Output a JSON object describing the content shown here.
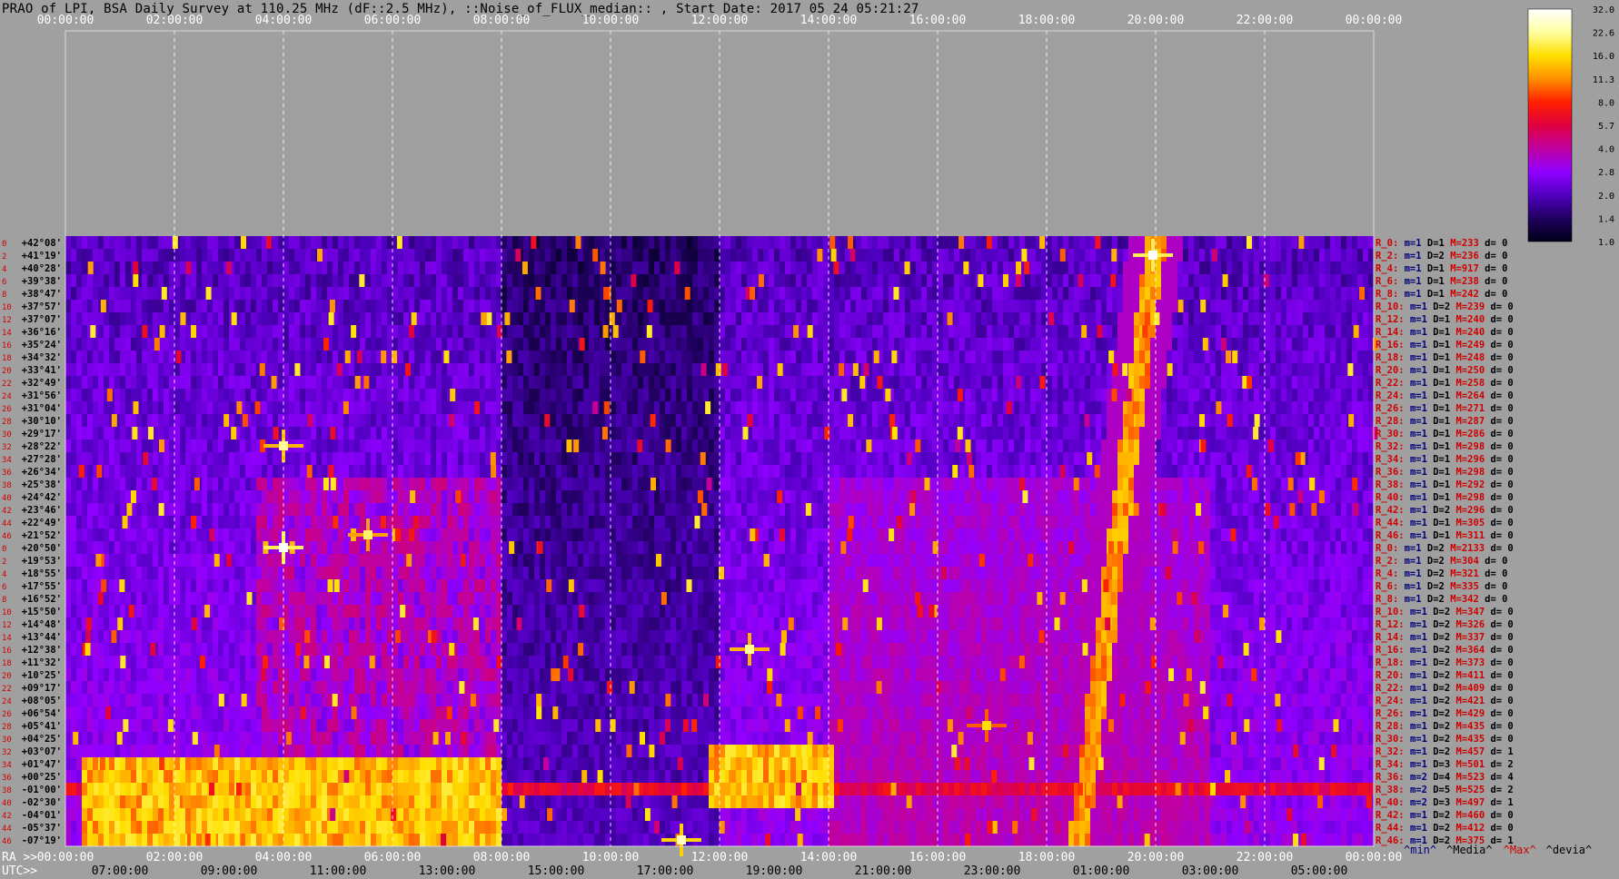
{
  "title": "PRAO of LPI, BSA Daily Survey at 110.25 MHz (dF::2.5 MHz), ::Noise_of_FLUX_median:: , Start Date: 2017 05 24 05:21:27",
  "colors": {
    "background": "#a0a0a0",
    "text_red": "#d00000",
    "text_navy": "#00007a",
    "text_black": "#000000"
  },
  "chart_data": {
    "type": "heatmap",
    "title": "PRAO of LPI, BSA Daily Survey at 110.25 MHz (dF::2.5 MHz), ::Noise_of_FLUX_median:: , Start Date: 2017 05 24 05:21:27",
    "top_axis_ticks": [
      "00:00:00",
      "02:00:00",
      "04:00:00",
      "06:00:00",
      "08:00:00",
      "10:00:00",
      "12:00:00",
      "14:00:00",
      "16:00:00",
      "18:00:00",
      "20:00:00",
      "22:00:00",
      "00:00:00"
    ],
    "ra_axis": {
      "prefix": "RA >>",
      "ticks": [
        "00:00:00",
        "02:00:00",
        "04:00:00",
        "06:00:00",
        "08:00:00",
        "10:00:00",
        "12:00:00",
        "14:00:00",
        "16:00:00",
        "18:00:00",
        "20:00:00",
        "22:00:00",
        "00:00:00"
      ]
    },
    "utc_axis": {
      "prefix": "UTC>>",
      "ticks": [
        "07:00:00",
        "09:00:00",
        "11:00:00",
        "13:00:00",
        "15:00:00",
        "17:00:00",
        "19:00:00",
        "21:00:00",
        "23:00:00",
        "01:00:00",
        "03:00:00",
        "05:00:00"
      ]
    },
    "x_range_hours": [
      0,
      24
    ],
    "declinations": [
      "+42°08'",
      "+41°19'",
      "+40°28'",
      "+39°38'",
      "+38°47'",
      "+37°57'",
      "+37°07'",
      "+36°16'",
      "+35°24'",
      "+34°32'",
      "+33°41'",
      "+32°49'",
      "+31°56'",
      "+31°04'",
      "+30°10'",
      "+29°17'",
      "+28°22'",
      "+27°28'",
      "+26°34'",
      "+25°38'",
      "+24°42'",
      "+23°46'",
      "+22°49'",
      "+21°52'",
      "+20°50'",
      "+19°53'",
      "+18°55'",
      "+17°55'",
      "+16°52'",
      "+15°50'",
      "+14°48'",
      "+13°44'",
      "+12°38'",
      "+11°32'",
      "+10°25'",
      "+09°17'",
      "+08°05'",
      "+06°54'",
      "+05°41'",
      "+04°25'",
      "+03°07'",
      "+01°47'",
      "+00°25'",
      "-01°00'",
      "-02°30'",
      "-04°01'",
      "-05°37'",
      "-07°19'"
    ],
    "row_indices": [
      "0",
      "2",
      "4",
      "6",
      "8",
      "10",
      "12",
      "14",
      "16",
      "18",
      "20",
      "22",
      "24",
      "26",
      "28",
      "30",
      "32",
      "34",
      "36",
      "38",
      "40",
      "42",
      "44",
      "46",
      "0",
      "2",
      "4",
      "6",
      "8",
      "10",
      "12",
      "14",
      "16",
      "18",
      "20",
      "22",
      "24",
      "26",
      "28",
      "30",
      "32",
      "34",
      "36",
      "38",
      "40",
      "42",
      "44",
      "46"
    ],
    "colorbar": {
      "ticks": [
        "32.0",
        "22.6",
        "16.0",
        "11.3",
        "8.0",
        "5.7",
        "4.0",
        "2.8",
        "2.0",
        "1.4",
        "1.0"
      ],
      "scale": "log",
      "range": [
        1.0,
        32.0
      ],
      "colors": [
        "#ffffff",
        "#ffffa0",
        "#ffe000",
        "#ff9000",
        "#ff2000",
        "#e00040",
        "#c000a0",
        "#9000ff",
        "#5000c0",
        "#200060",
        "#000018"
      ]
    },
    "row_stats": [
      {
        "label": "R_0:",
        "m": 1,
        "D": 1,
        "M": 233,
        "d": 0
      },
      {
        "label": "R_2:",
        "m": 1,
        "D": 2,
        "M": 236,
        "d": 0
      },
      {
        "label": "R_4:",
        "m": 1,
        "D": 1,
        "M": 917,
        "d": 0
      },
      {
        "label": "R_6:",
        "m": 1,
        "D": 1,
        "M": 238,
        "d": 0
      },
      {
        "label": "R_8:",
        "m": 1,
        "D": 1,
        "M": 242,
        "d": 0
      },
      {
        "label": "R_10:",
        "m": 1,
        "D": 2,
        "M": 239,
        "d": 0
      },
      {
        "label": "R_12:",
        "m": 1,
        "D": 1,
        "M": 240,
        "d": 0
      },
      {
        "label": "R_14:",
        "m": 1,
        "D": 1,
        "M": 240,
        "d": 0
      },
      {
        "label": "R_16:",
        "m": 1,
        "D": 1,
        "M": 249,
        "d": 0
      },
      {
        "label": "R_18:",
        "m": 1,
        "D": 1,
        "M": 248,
        "d": 0
      },
      {
        "label": "R_20:",
        "m": 1,
        "D": 1,
        "M": 250,
        "d": 0
      },
      {
        "label": "R_22:",
        "m": 1,
        "D": 1,
        "M": 258,
        "d": 0
      },
      {
        "label": "R_24:",
        "m": 1,
        "D": 1,
        "M": 264,
        "d": 0
      },
      {
        "label": "R_26:",
        "m": 1,
        "D": 1,
        "M": 271,
        "d": 0
      },
      {
        "label": "R_28:",
        "m": 1,
        "D": 1,
        "M": 287,
        "d": 0
      },
      {
        "label": "R_30:",
        "m": 1,
        "D": 1,
        "M": 286,
        "d": 0
      },
      {
        "label": "R_32:",
        "m": 1,
        "D": 1,
        "M": 298,
        "d": 0
      },
      {
        "label": "R_34:",
        "m": 1,
        "D": 1,
        "M": 296,
        "d": 0
      },
      {
        "label": "R_36:",
        "m": 1,
        "D": 1,
        "M": 298,
        "d": 0
      },
      {
        "label": "R_38:",
        "m": 1,
        "D": 1,
        "M": 292,
        "d": 0
      },
      {
        "label": "R_40:",
        "m": 1,
        "D": 1,
        "M": 298,
        "d": 0
      },
      {
        "label": "R_42:",
        "m": 1,
        "D": 2,
        "M": 296,
        "d": 0
      },
      {
        "label": "R_44:",
        "m": 1,
        "D": 1,
        "M": 305,
        "d": 0
      },
      {
        "label": "R_46:",
        "m": 1,
        "D": 1,
        "M": 311,
        "d": 0
      },
      {
        "label": "R_0:",
        "m": 1,
        "D": 2,
        "M": 2133,
        "d": 0
      },
      {
        "label": "R_2:",
        "m": 1,
        "D": 2,
        "M": 304,
        "d": 0
      },
      {
        "label": "R_4:",
        "m": 1,
        "D": 2,
        "M": 321,
        "d": 0
      },
      {
        "label": "R_6:",
        "m": 1,
        "D": 2,
        "M": 335,
        "d": 0
      },
      {
        "label": "R_8:",
        "m": 1,
        "D": 2,
        "M": 342,
        "d": 0
      },
      {
        "label": "R_10:",
        "m": 1,
        "D": 2,
        "M": 347,
        "d": 0
      },
      {
        "label": "R_12:",
        "m": 1,
        "D": 2,
        "M": 326,
        "d": 0
      },
      {
        "label": "R_14:",
        "m": 1,
        "D": 2,
        "M": 337,
        "d": 0
      },
      {
        "label": "R_16:",
        "m": 1,
        "D": 2,
        "M": 364,
        "d": 0
      },
      {
        "label": "R_18:",
        "m": 1,
        "D": 2,
        "M": 373,
        "d": 0
      },
      {
        "label": "R_20:",
        "m": 1,
        "D": 2,
        "M": 411,
        "d": 0
      },
      {
        "label": "R_22:",
        "m": 1,
        "D": 2,
        "M": 409,
        "d": 0
      },
      {
        "label": "R_24:",
        "m": 1,
        "D": 2,
        "M": 421,
        "d": 0
      },
      {
        "label": "R_26:",
        "m": 1,
        "D": 2,
        "M": 429,
        "d": 0
      },
      {
        "label": "R_28:",
        "m": 1,
        "D": 2,
        "M": 435,
        "d": 0
      },
      {
        "label": "R_30:",
        "m": 1,
        "D": 2,
        "M": 435,
        "d": 0
      },
      {
        "label": "R_32:",
        "m": 1,
        "D": 2,
        "M": 457,
        "d": 1
      },
      {
        "label": "R_34:",
        "m": 1,
        "D": 3,
        "M": 501,
        "d": 2
      },
      {
        "label": "R_36:",
        "m": 2,
        "D": 4,
        "M": 523,
        "d": 4
      },
      {
        "label": "R_38:",
        "m": 2,
        "D": 5,
        "M": 525,
        "d": 2
      },
      {
        "label": "R_40:",
        "m": 2,
        "D": 3,
        "M": 497,
        "d": 1
      },
      {
        "label": "R_42:",
        "m": 1,
        "D": 2,
        "M": 460,
        "d": 0
      },
      {
        "label": "R_44:",
        "m": 1,
        "D": 2,
        "M": 412,
        "d": 0
      },
      {
        "label": "R_46:",
        "m": 1,
        "D": 2,
        "M": 375,
        "d": 1
      }
    ],
    "stats_legend": [
      {
        "text": "^min^",
        "color": "#00007a"
      },
      {
        "text": "^Media^",
        "color": "#000000"
      },
      {
        "text": "^Max^",
        "color": "#d00000"
      },
      {
        "text": "^devia^",
        "color": "#000000"
      }
    ],
    "features": {
      "dense_blocks": [
        {
          "ra_start_h": 0.3,
          "ra_end_h": 8.0,
          "dec_from": "+01°47'",
          "dec_to": "-07°19'",
          "level": 14
        },
        {
          "ra_start_h": 11.8,
          "ra_end_h": 14.1,
          "dec_from": "+03°07'",
          "dec_to": "-02°30'",
          "level": 14
        },
        {
          "ra_start_h": 3.5,
          "ra_end_h": 8.0,
          "dec_from": "+25°38'",
          "dec_to": "+03°07'",
          "level": 3.5
        }
      ],
      "bright_sources": [
        {
          "ra_h": 19.95,
          "dec": "+41°19'",
          "level": 32
        },
        {
          "ra_h": 4.0,
          "dec": "+20°50'",
          "level": 32
        },
        {
          "ra_h": 5.55,
          "dec": "+21°52'",
          "level": 20
        },
        {
          "ra_h": 4.0,
          "dec": "+28°22'",
          "level": 22
        },
        {
          "ra_h": 12.55,
          "dec": "+12°38'",
          "level": 22
        },
        {
          "ra_h": 11.3,
          "dec": "-07°19'",
          "level": 25
        },
        {
          "ra_h": 16.9,
          "dec": "+05°41'",
          "level": 16
        }
      ],
      "diagonal_track": {
        "ra_start_h": 18.6,
        "dec_start": "-07°19'",
        "ra_end_h": 20.0,
        "dec_end": "+42°08'"
      },
      "equatorial_band": {
        "dec": "-01°00'",
        "level": 6
      }
    }
  }
}
